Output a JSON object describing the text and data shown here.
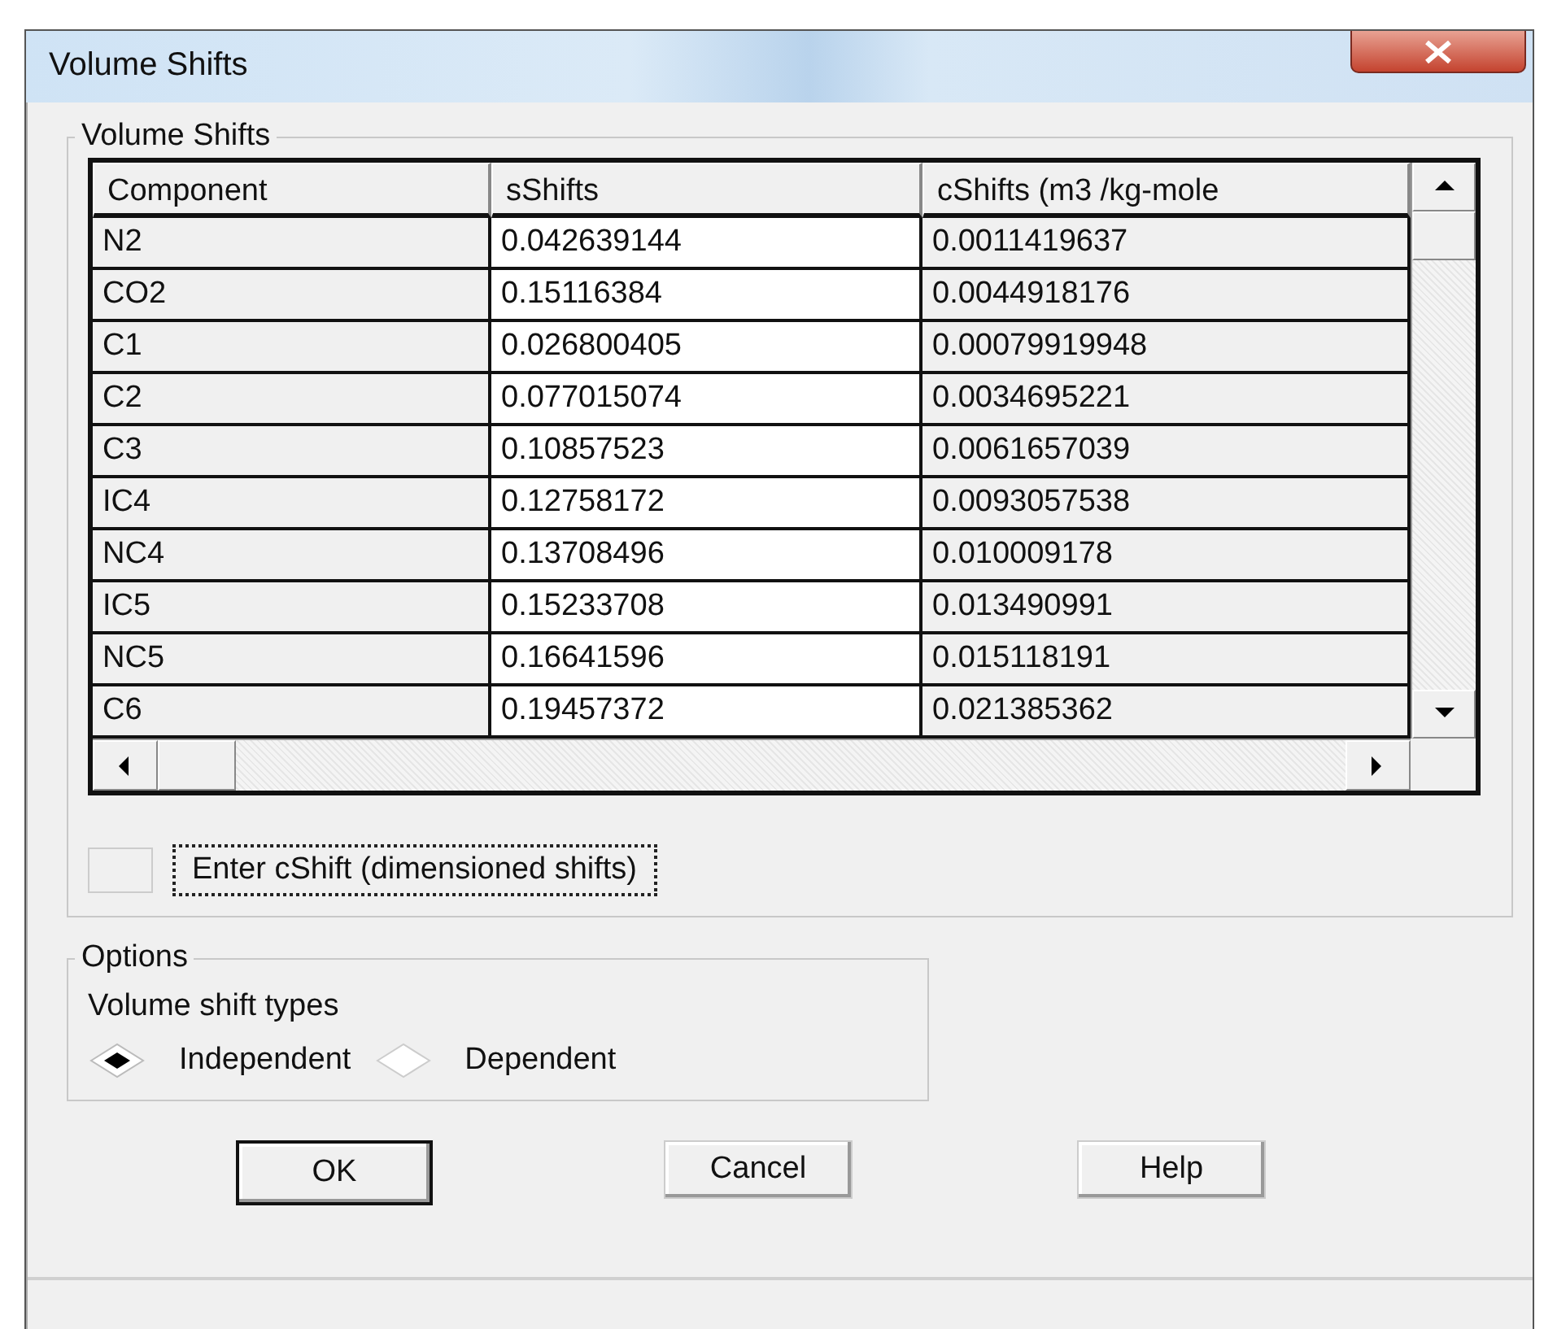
{
  "window": {
    "title": "Volume Shifts"
  },
  "group": {
    "title": "Volume Shifts"
  },
  "table": {
    "columns": [
      {
        "label": "Component",
        "editable": false
      },
      {
        "label": "sShifts",
        "editable": true
      },
      {
        "label": "cShifts (m3 /kg-mole",
        "editable": false
      }
    ],
    "rows": [
      [
        "N2",
        "0.042639144",
        "0.0011419637"
      ],
      [
        "CO2",
        "0.15116384",
        "0.0044918176"
      ],
      [
        "C1",
        "0.026800405",
        "0.00079919948"
      ],
      [
        "C2",
        "0.077015074",
        "0.0034695221"
      ],
      [
        "C3",
        "0.10857523",
        "0.0061657039"
      ],
      [
        "IC4",
        "0.12758172",
        "0.0093057538"
      ],
      [
        "NC4",
        "0.13708496",
        "0.010009178"
      ],
      [
        "IC5",
        "0.15233708",
        "0.013490991"
      ],
      [
        "NC5",
        "0.16641596",
        "0.015118191"
      ],
      [
        "C6",
        "0.19457372",
        "0.021385362"
      ]
    ]
  },
  "toggle": {
    "label": "Enter cShift (dimensioned shifts)",
    "checked": false,
    "focused": true
  },
  "options": {
    "title": "Options",
    "label": "Volume shift types",
    "radios": [
      {
        "label": "Independent",
        "selected": true
      },
      {
        "label": "Dependent",
        "selected": false
      }
    ]
  },
  "buttons": [
    {
      "label": "OK",
      "default": true
    },
    {
      "label": "Cancel",
      "default": false
    },
    {
      "label": "Help",
      "default": false
    }
  ]
}
